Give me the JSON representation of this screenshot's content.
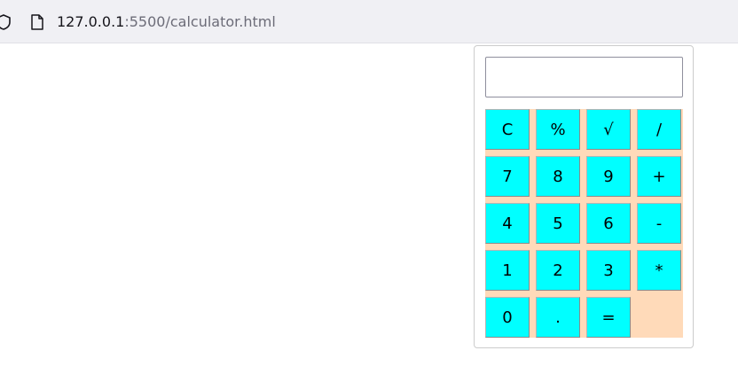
{
  "browser": {
    "url_host": "127.0.0.1",
    "url_path": ":5500/calculator.html"
  },
  "calculator": {
    "display_value": "",
    "keys": [
      [
        "C",
        "%",
        "√",
        "/"
      ],
      [
        "7",
        "8",
        "9",
        "+"
      ],
      [
        "4",
        "5",
        "6",
        "-"
      ],
      [
        "1",
        "2",
        "3",
        "*"
      ],
      [
        "0",
        ".",
        "="
      ]
    ]
  },
  "colors": {
    "key_background": "#00ffff",
    "keypad_background": "#ffdab9"
  }
}
